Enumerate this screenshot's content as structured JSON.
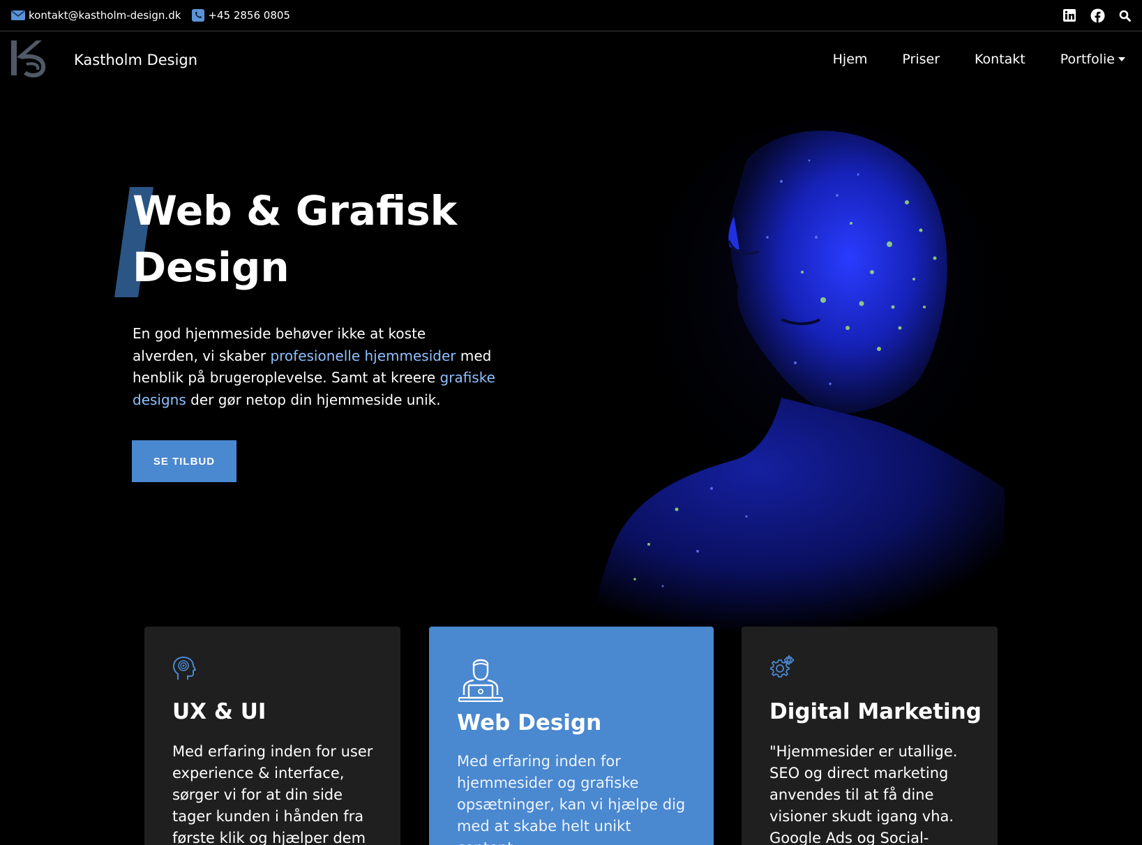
{
  "topbar": {
    "email": "kontakt@kastholm-design.dk",
    "phone": "+45 2856 0805",
    "social": [
      "linkedin-icon",
      "facebook-icon",
      "search-icon"
    ]
  },
  "nav": {
    "brand": "Kastholm Design",
    "links": [
      "Hjem",
      "Priser",
      "Kontakt",
      "Portfolie"
    ]
  },
  "hero": {
    "title_line1": "Web & Grafisk",
    "title_line2": "Design",
    "p1": "En god hjemmeside behøver ikke at koste alverden, vi skaber ",
    "link1": "profesionelle hjemmesider",
    "p2": " med henblik på brugeroplevelse. Samt at kreere ",
    "link2": "grafiske designs",
    "p3": " der gør netop din hjemmeside unik.",
    "cta": "SE TILBUD"
  },
  "services": [
    {
      "title": "UX & UI",
      "text": "Med erfaring inden for user experience & interface, sørger vi for at din side tager kunden i hånden fra første klik og hjælper dem"
    },
    {
      "title": "Web Design",
      "text": "Med erfaring inden for hjemmesider og grafiske opsætninger, kan vi hjælpe dig med at skabe helt unikt content"
    },
    {
      "title": "Digital Marketing",
      "text": "\"Hjemmesider er utallige. SEO og direct marketing anvendes til at få dine visioner skudt igang vha. Google Ads og Social-"
    }
  ],
  "colors": {
    "accent": "#4a88d0",
    "link": "#8fc0ff",
    "background": "#000000",
    "card": "#1f1f1f"
  }
}
